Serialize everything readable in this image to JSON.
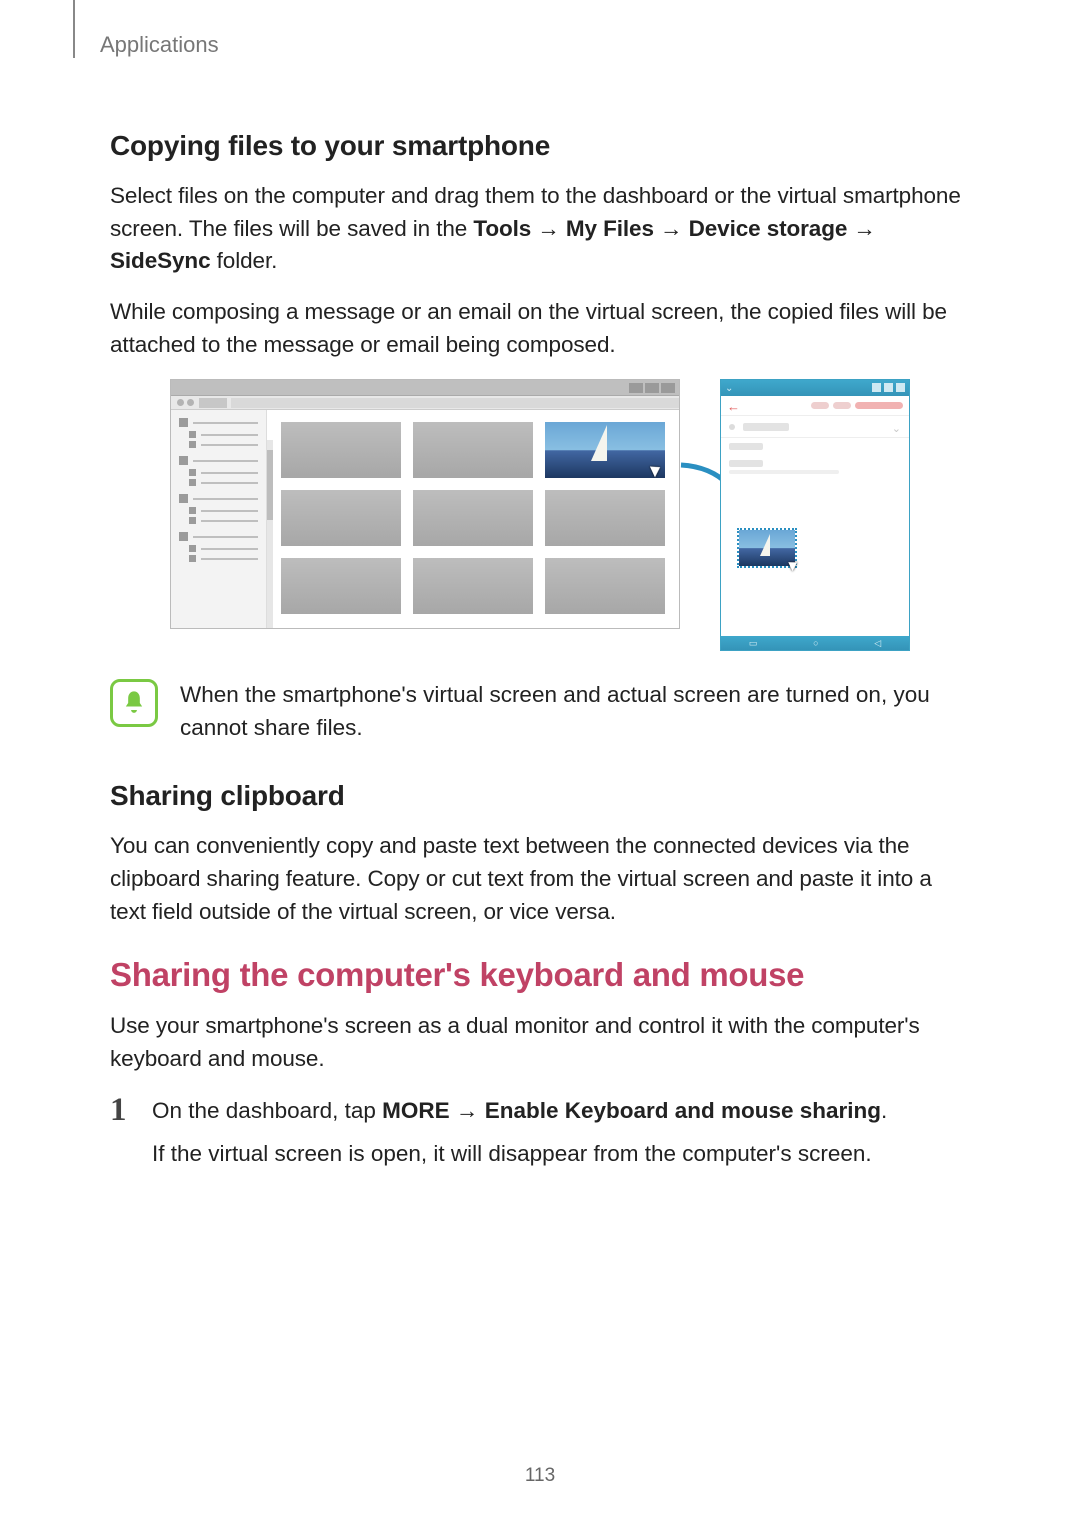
{
  "header": {
    "section": "Applications"
  },
  "h_copy": "Copying files to your smartphone",
  "p_copy_1a": "Select files on the computer and drag them to the dashboard or the virtual smartphone screen. The files will be saved in the ",
  "path": {
    "tools": "Tools",
    "myfiles": "My Files",
    "devstorage": "Device storage",
    "sidesync": "SideSync"
  },
  "p_copy_1b": " folder.",
  "p_copy_2": "While composing a message or an email on the virtual screen, the copied files will be attached to the message or email being composed.",
  "note": "When the smartphone's virtual screen and actual screen are turned on, you cannot share files.",
  "h_clip": "Sharing clipboard",
  "p_clip": "You can conveniently copy and paste text between the connected devices via the clipboard sharing feature. Copy or cut text from the virtual screen and paste it into a text field outside of the virtual screen, or vice versa.",
  "h_share": "Sharing the computer's keyboard and mouse",
  "p_share": "Use your smartphone's screen as a dual monitor and control it with the computer's keyboard and mouse.",
  "step1": {
    "num": "1",
    "a": "On the dashboard, tap ",
    "more": "MORE",
    "enable": "Enable Keyboard and mouse sharing",
    "b": ".",
    "c": "If the virtual screen is open, it will disappear from the computer's screen."
  },
  "arrow": " → ",
  "page_number": "113"
}
